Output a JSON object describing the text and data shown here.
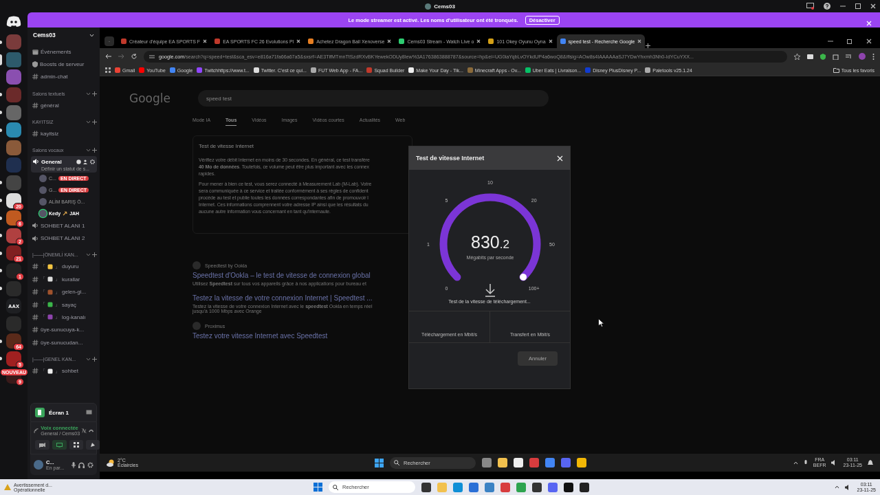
{
  "titlebar": {
    "title": "Cems03"
  },
  "banner": {
    "message": "Le mode streamer est activé. Les noms d'utilisateur ont été tronqués.",
    "button": "Désactiver"
  },
  "servers": [
    {
      "selected": false,
      "unread": true
    },
    {
      "selected": true,
      "unread": false
    },
    {
      "selected": false,
      "unread": false
    },
    {
      "selected": false,
      "unread": true
    },
    {
      "selected": false,
      "unread": true
    },
    {
      "selected": false,
      "unread": true
    },
    {
      "selected": false,
      "unread": false
    },
    {
      "selected": false,
      "unread": false
    },
    {
      "selected": false,
      "unread": true
    },
    {
      "selected": false,
      "unread": true,
      "badge": "20"
    },
    {
      "selected": false,
      "unread": true,
      "badge": "6"
    },
    {
      "selected": false,
      "unread": true,
      "badge": "2"
    },
    {
      "selected": false,
      "unread": true,
      "badge": "21"
    },
    {
      "selected": false,
      "unread": true,
      "badge": "1"
    },
    {
      "selected": false,
      "unread": true
    },
    {
      "selected": false,
      "unread": false,
      "label": "AAX"
    },
    {
      "selected": false,
      "unread": false
    },
    {
      "selected": false,
      "unread": true,
      "badge": "64"
    },
    {
      "selected": false,
      "unread": true,
      "badge": "5"
    },
    {
      "selected": false,
      "unread": false,
      "badge": "9",
      "tag": "NOUVEAU"
    }
  ],
  "sidebar": {
    "server_name": "Cems03",
    "items": [
      {
        "kind": "calendar",
        "name": "Événements"
      },
      {
        "kind": "boost",
        "name": "Boosts de serveur"
      },
      {
        "kind": "text",
        "name": "admin-chat"
      },
      {
        "kind": "category",
        "name": "Salons textuels"
      },
      {
        "kind": "text",
        "name": "général"
      },
      {
        "kind": "category",
        "name": "KAYITSIZ"
      },
      {
        "kind": "text",
        "name": "kayitsiz"
      },
      {
        "kind": "category",
        "name": "Salons vocaux"
      },
      {
        "kind": "voice",
        "name": "General",
        "selected": true,
        "status": "Définir un statut de s...",
        "members": [
          {
            "name": "C...",
            "badge": "EN DIRECT",
            "speaking": false
          },
          {
            "name": "G...",
            "badge": "EN DIRECT",
            "speaking": false
          },
          {
            "name": "ALİM BARIŞ Ö...",
            "speaking": false
          },
          {
            "name": "Kedy",
            "speaking": true,
            "tag": "JAH"
          }
        ]
      },
      {
        "kind": "voice",
        "name": "SOHBET ALANI 1",
        "selected": false
      },
      {
        "kind": "voice",
        "name": "SOHBET ALANI 2",
        "selected": false
      },
      {
        "kind": "category",
        "name": "|——|ÖNEMLİ KAN..."
      },
      {
        "kind": "bell-channel",
        "name": "duyuru",
        "open": "「",
        "close": "」"
      },
      {
        "kind": "page-channel",
        "name": "kurallar",
        "open": "「",
        "close": "」"
      },
      {
        "kind": "door-channel",
        "name": "gelen-gi...",
        "open": "「",
        "close": "」"
      },
      {
        "kind": "check-channel",
        "name": "sayaç",
        "open": "「",
        "close": "」"
      },
      {
        "kind": "disk-channel",
        "name": "log-kanalı",
        "open": "「",
        "close": "」"
      },
      {
        "kind": "text",
        "name": "üye-sunucuya-k..."
      },
      {
        "kind": "text",
        "name": "üye-sunucudan..."
      },
      {
        "kind": "category",
        "name": "|——|GENEL KAN..."
      },
      {
        "kind": "speech-channel",
        "name": "sohbet",
        "open": "「",
        "close": "」"
      }
    ],
    "screen_share": {
      "title": "Écran 1"
    },
    "voice": {
      "status": "Voix connectée",
      "channel": "General / Cems03"
    },
    "user": {
      "name": "C...",
      "status": "En par..."
    }
  },
  "browser": {
    "tabs": [
      {
        "title": "Créateur d'équipe EA SPORTS F",
        "selected": false
      },
      {
        "title": "EA SPORTS FC 26 Evolutions Pl",
        "selected": false
      },
      {
        "title": "Achetez Dragon Ball Xenoverse",
        "selected": false
      },
      {
        "title": "Cems03 Stream - Watch Live o",
        "selected": false
      },
      {
        "title": "101 Okey Oyunu Oyna",
        "selected": false
      },
      {
        "title": "speed test - Recherche Google",
        "selected": true
      }
    ],
    "url_host": "google.com",
    "url_path": "/search?q=speed+test&sca_esv=e816a71fa66a67a5&sxsrf=AE3TifMTmnTtSzdRXvBKYewekODUy8lew%3A1763863888787&source=hp&ei=UG0iaYqbLvOYkdUP4a6woQ8&iflsig=AOw8s4IAAAAAaSJ7YDwYhxmh3Nh0-IdYCuYXX...",
    "bookmarks": [
      "Gmail",
      "YouTube",
      "Google",
      "Twitchhttps://www.t...",
      "Twitter. C'est ce qui...",
      "FUT Web App - FA...",
      "Squad Builder",
      "Make Your Day - Tik...",
      "Minecraft Apps - Ov...",
      "Uber Eats | Livraison...",
      "Disney PlusDisney P...",
      "Paletools v25.1.24"
    ],
    "all_bookmarks": "Tous les favoris"
  },
  "page": {
    "logo": "Google",
    "query": "speed test",
    "nav": [
      {
        "label": "Mode IA",
        "selected": false
      },
      {
        "label": "Tous",
        "selected": true
      },
      {
        "label": "Vidéos",
        "selected": false
      },
      {
        "label": "Images",
        "selected": false
      },
      {
        "label": "Vidéos courtes",
        "selected": false
      },
      {
        "label": "Actualités",
        "selected": false
      },
      {
        "label": "Web",
        "selected": false
      }
    ],
    "card_title": "Test de vitesse Internet",
    "paragraphs": [
      [
        "Vérifiez votre débit Internet en moins de 30 secondes. En général, ce test transfère",
        "**40 Mo de données**. Toutefois, ce volume peut être plus important avec les connex",
        "rapides."
      ],
      [
        "Pour mener à bien ce test, vous serez connecté à Measurement Lab (M-Lab). Votre",
        "sera communiquée à ce service et traitée conformément à ses règles de confident",
        "procède au test et publie toutes les données correspondantes afin de promouvoir l",
        "Internet. Ces informations comprennent votre adresse IP ainsi que les résultats du",
        "aucune autre information vous concernant en tant qu'internaute."
      ]
    ],
    "results": [
      {
        "site": "Speedtest by Ookla",
        "title": "Speedtest d'Ookla – le test de vitesse de connexion global",
        "snippet": [
          "Utilisez **Speedtest** sur tous vos appareils grâce à nos applications pour bureau et"
        ]
      },
      {
        "title": "Testez la vitesse de votre connexion Internet | Speedtest ...",
        "snippet": [
          "Testez la vitesse de votre connexion Internet avec le **speedtest** Ookla en temps réel",
          "jusqu'à 1000 Mbps avec Orange"
        ]
      },
      {
        "site": "Proximus",
        "title": "Testez votre vitesse Internet avec Speedtest"
      }
    ]
  },
  "dialog": {
    "title": "Test de vitesse Internet",
    "ticks": [
      "0",
      "1",
      "5",
      "10",
      "20",
      "50",
      "100+"
    ],
    "reading_whole": "830",
    "reading_fraction": ".2",
    "unit": "Mégabits par seconde",
    "level": 1,
    "status": "Test de la vitesse de téléchargement...",
    "download_label": "Téléchargement en Mbit/s",
    "upload_label": "Transfert en Mbit/s",
    "cancel": "Annuler"
  },
  "stream_taskbar": {
    "temperature": "2°C",
    "weather": "Éclaircies",
    "search_placeholder": "Rechercher",
    "lang": "FRA",
    "layout": "BEFR",
    "time": "03:11",
    "date": "23-11-25"
  },
  "taskbar": {
    "notice_title": "Avertissement d...",
    "notice_status": "Opérationnelle",
    "search_placeholder": "Rechercher",
    "time": "03:11",
    "date": "23-11-25"
  }
}
